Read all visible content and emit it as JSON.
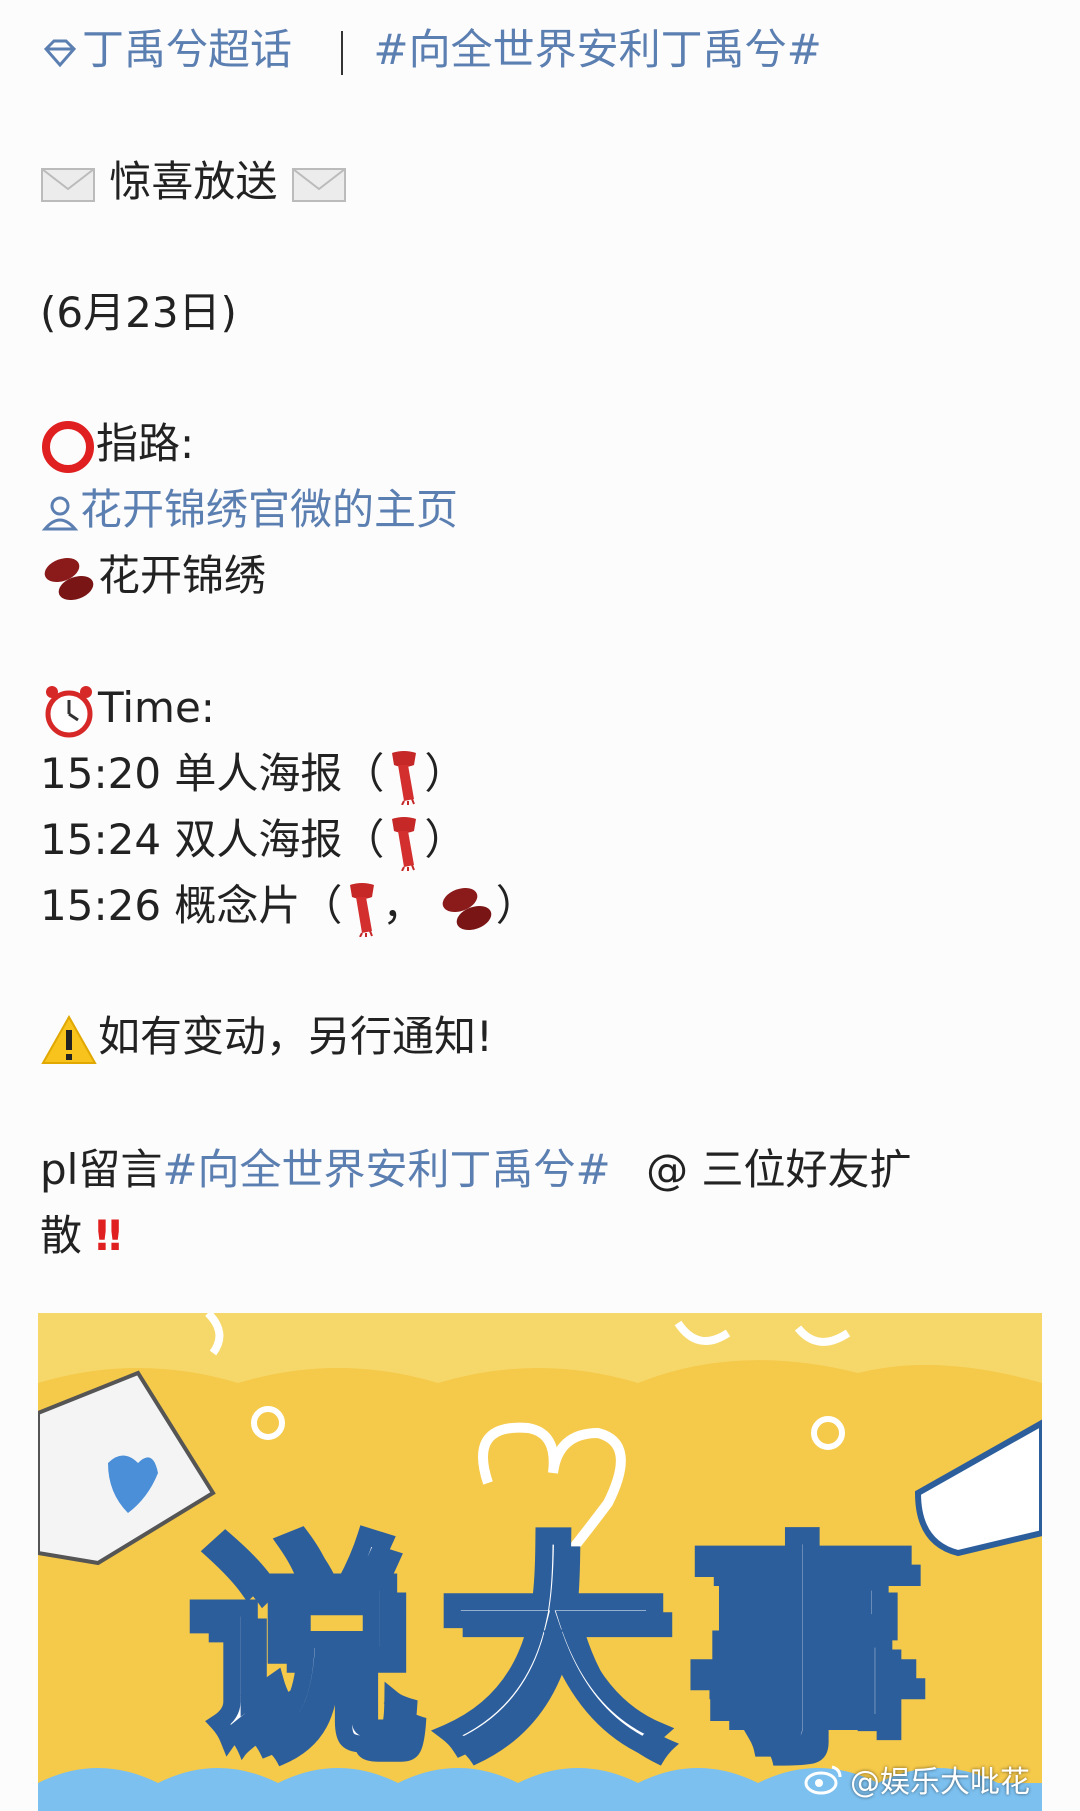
{
  "header": {
    "topic": "丁禹兮超话",
    "hashtag": "#向全世界安利丁禹兮#"
  },
  "post": {
    "surprise": "惊喜放送",
    "date": "(6月23日)",
    "guide_label": "指路:",
    "profile_link": "花开锦绣官微的主页",
    "beans_label": "花开锦绣",
    "time_label": "Time:",
    "schedule": [
      {
        "time": "15:20",
        "label": "单人海报（",
        "close": "）"
      },
      {
        "time": "15:24",
        "label": "双人海报（",
        "close": "）"
      },
      {
        "time": "15:26",
        "label": "概念片（",
        "mid": "，",
        "close": "）"
      }
    ],
    "notice": "如有变动，另行通知!",
    "pl_prefix": "pl留言",
    "pl_hashtag": "#向全世界安利丁禹兮#",
    "pl_suffix": "@ 三位好友扩",
    "pl_end": "散"
  },
  "image": {
    "title": "说大事",
    "watermark": "@娱乐大吡花"
  },
  "colors": {
    "link": "#5b7fb1",
    "image_bg": "#f5c94a",
    "title_stroke": "#2d5e9c"
  }
}
